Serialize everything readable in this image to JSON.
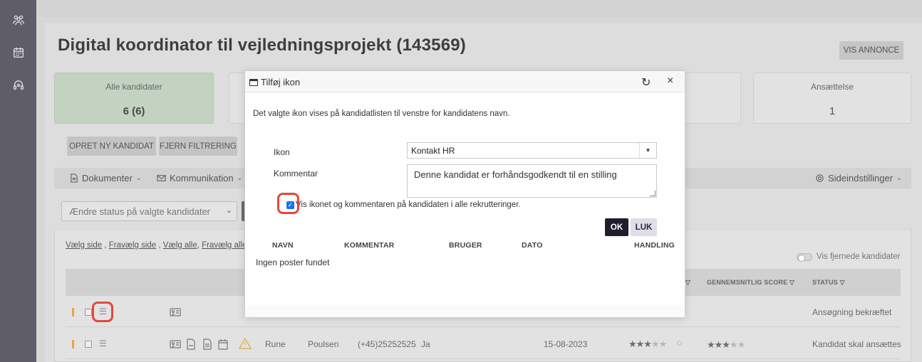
{
  "sidebar": {
    "icons": [
      "users-icon",
      "calendar-icon",
      "headset-icon"
    ]
  },
  "page": {
    "title": "Digital koordinator til vejledningsprojekt (143569)",
    "vis_annonce": "VIS ANNONCE"
  },
  "stats": [
    {
      "label": "Alle kandidater",
      "value": "6 (6)"
    },
    {
      "label": "Ansættelse",
      "value": "1"
    }
  ],
  "actions": {
    "opret": "OPRET NY KANDIDAT",
    "fjern": "FJERN FILTRERING"
  },
  "toolbar": {
    "dokumenter": "Dokumenter",
    "kommunikation": "Kommunikation",
    "sideindstillinger": "Sideindstillinger"
  },
  "status_select": {
    "value": "Ændre status på valgte kandidater"
  },
  "list": {
    "links": [
      "Vælg side",
      "Fravælg side",
      "Vælg alle",
      "Fravælg alle"
    ],
    "vis_fjernede": "Vis fjernede kandidater",
    "headers": {
      "score": "GENNEMSNITLIG SCORE",
      "status": "STATUS"
    },
    "rows": [
      {
        "first": "",
        "last": "",
        "phone": "",
        "flag": "",
        "date": "",
        "rating_on": 0,
        "score_on": 0,
        "status": "Ansøgning bekræftet"
      },
      {
        "first": "Rune",
        "last": "Poulsen",
        "phone": "(+45)25252525",
        "flag": "Ja",
        "date": "15-08-2023",
        "rating_on": 3,
        "score_on": 3,
        "status": "Kandidat skal ansættes"
      }
    ]
  },
  "dialog": {
    "title": "Tilføj ikon",
    "description": "Det valgte ikon vises på kandidatlisten til venstre for kandidatens navn.",
    "ikon_label": "Ikon",
    "ikon_value": "Kontakt HR",
    "kommentar_label": "Kommentar",
    "kommentar_value": "Denne kandidat er forhåndsgodkendt til en stilling",
    "checkbox_label": "Vis ikonet og kommentaren på kandidaten i alle rekrutteringer.",
    "checkbox_checked": true,
    "ok": "OK",
    "luk": "LUK",
    "table_headers": [
      "NAVN",
      "KOMMENTAR",
      "BRUGER",
      "DATO",
      "HANDLING"
    ],
    "empty": "Ingen poster fundet"
  }
}
